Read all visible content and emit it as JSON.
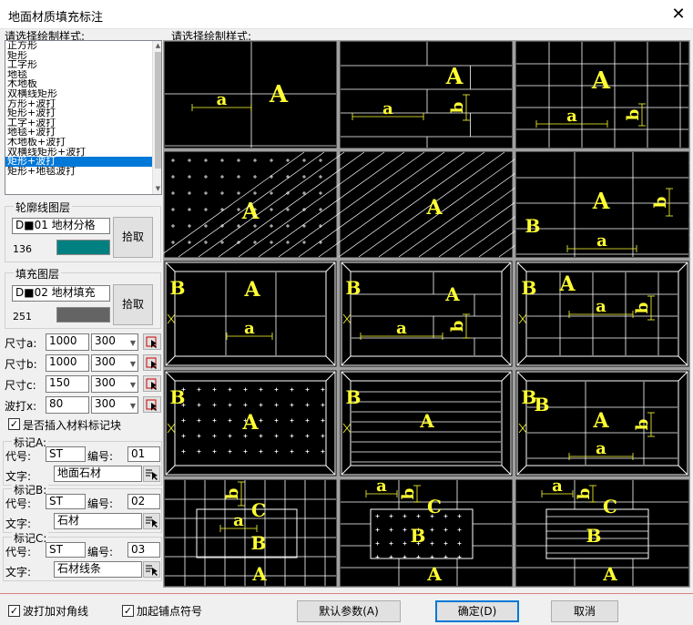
{
  "window": {
    "title": "地面材质填充标注",
    "close_glyph": "✕"
  },
  "style_list": {
    "label": "请选择绘制样式:",
    "items": [
      "正方形",
      "矩形",
      "工字形",
      "地毯",
      "木地板",
      "双横线矩形",
      "方形+波打",
      "矩形+波打",
      "工字+波打",
      "地毯+波打",
      "木地板+波打",
      "双横线矩形+波打",
      "矩形+波打",
      "矩形+地毯波打"
    ],
    "selected_index": 12
  },
  "preview": {
    "label": "请选择绘制样式:",
    "selected_index": 15
  },
  "outline_layer": {
    "title": "轮廓线图层",
    "name": "D■01 地材分格",
    "color_index": "136",
    "color": "#008080",
    "button": "拾取"
  },
  "fill_layer": {
    "title": "填充图层",
    "name": "D■02 地材填充",
    "color_index": "251",
    "color": "#646464",
    "button": "拾取"
  },
  "sizes": [
    {
      "label": "尺寸a:",
      "value": "1000",
      "option": "300"
    },
    {
      "label": "尺寸b:",
      "value": "1000",
      "option": "300"
    },
    {
      "label": "尺寸c:",
      "value": "150",
      "option": "300"
    },
    {
      "label": "波打x:",
      "value": "80",
      "option": "300"
    }
  ],
  "insert_marker": {
    "label": "是否插入材料标记块",
    "checked": true
  },
  "markers": [
    {
      "title": "标记A:",
      "code_label": "代号:",
      "code": "ST",
      "num_label": "编号:",
      "num": "01",
      "text_label": "文字:",
      "text": "地面石材"
    },
    {
      "title": "标记B:",
      "code_label": "代号:",
      "code": "ST",
      "num_label": "编号:",
      "num": "02",
      "text_label": "文字:",
      "text": "石材"
    },
    {
      "title": "标记C:",
      "code_label": "代号:",
      "code": "ST",
      "num_label": "编号:",
      "num": "03",
      "text_label": "文字:",
      "text": "石材线条"
    }
  ],
  "options": {
    "corner_line": {
      "label": "波打加对角线",
      "checked": true
    },
    "start_tile": {
      "label": "加起铺点符号",
      "checked": true
    }
  },
  "buttons": {
    "defaults": "默认参数(A)",
    "ok": "确定(D)",
    "cancel": "取消"
  },
  "tile_labels": {
    "A": "A",
    "B": "B",
    "C": "C",
    "a": "a",
    "b": "b",
    "c": "c",
    "x": "x"
  }
}
